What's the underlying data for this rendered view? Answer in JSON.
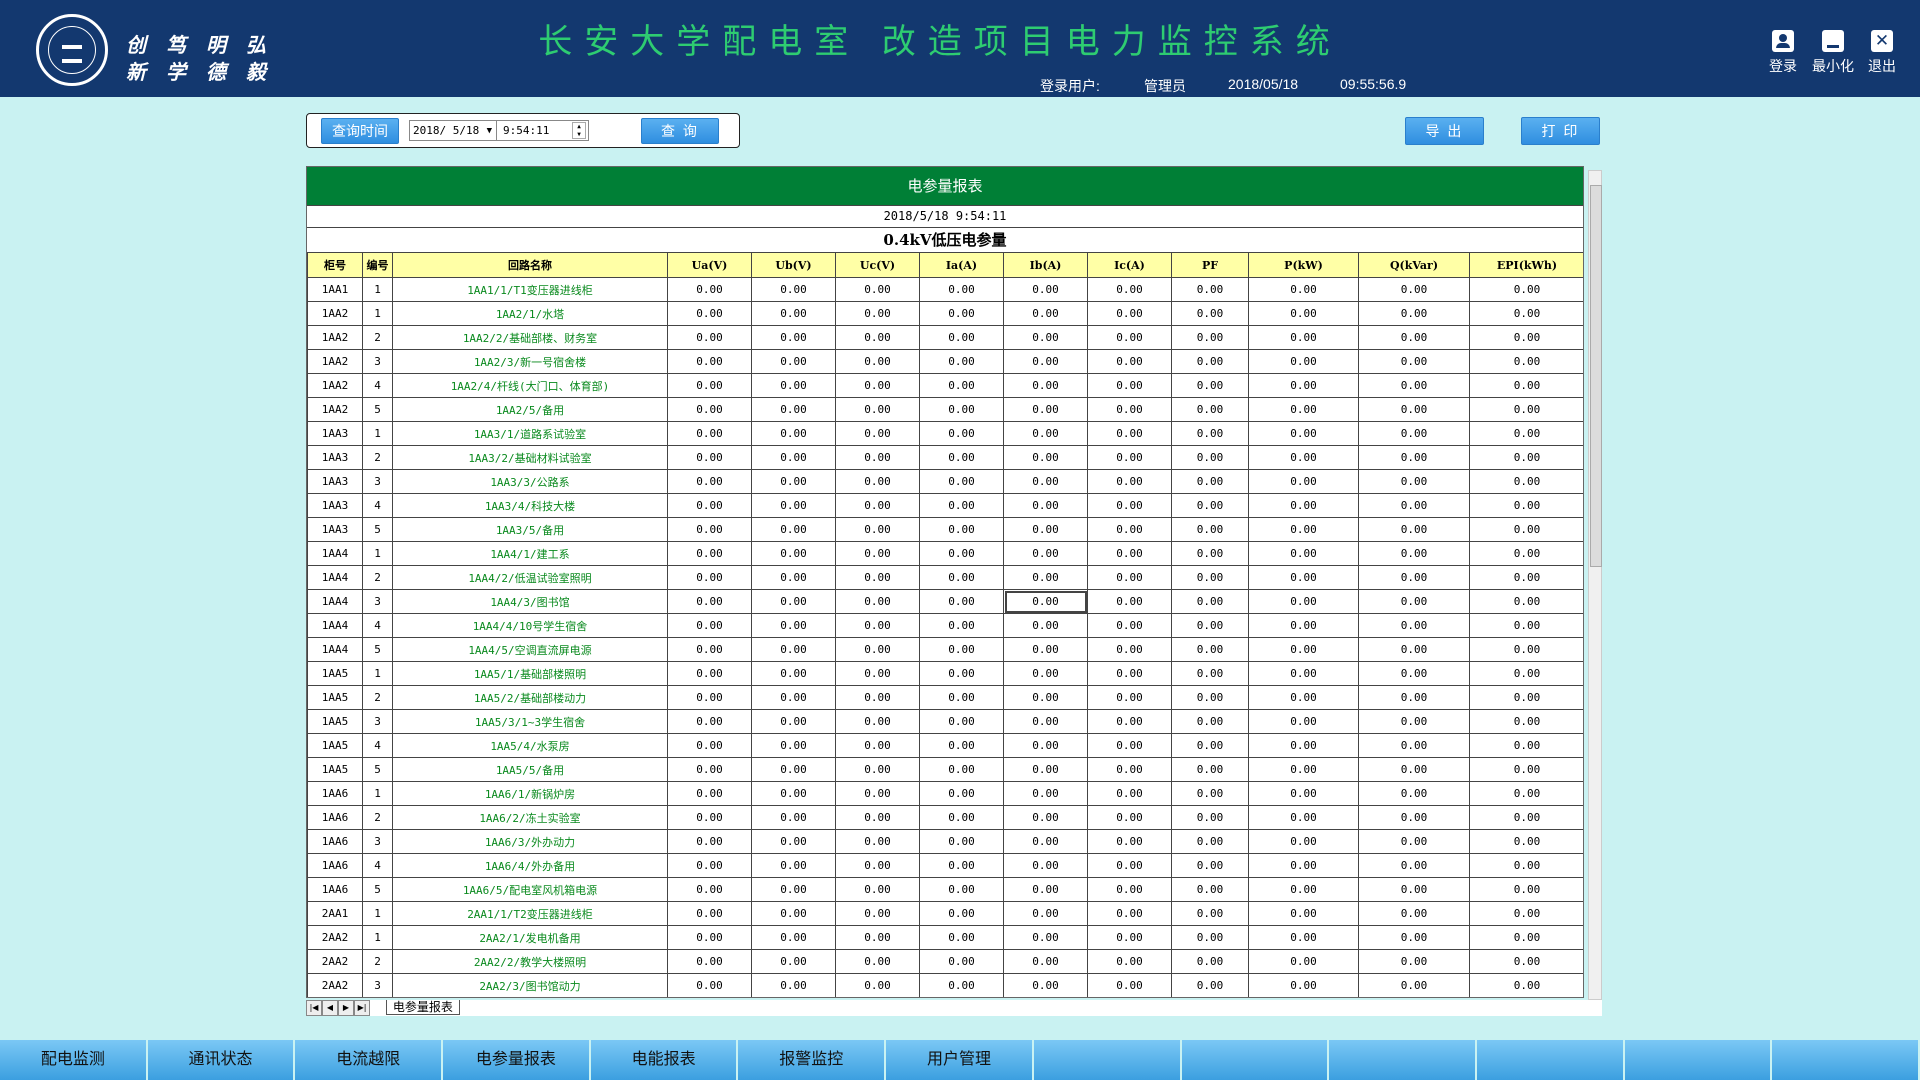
{
  "header": {
    "motto": [
      "创",
      "笃",
      "明",
      "弘",
      "新",
      "学",
      "德",
      "毅"
    ],
    "title": "长安大学配电室 改造项目电力监控系统",
    "login_label": "登录用户:",
    "user": "管理员",
    "date": "2018/05/18",
    "time": "09:55:56.9",
    "buttons": {
      "login": "登录",
      "minimize": "最小化",
      "exit": "退出"
    }
  },
  "query": {
    "label_button": "查询时间",
    "date_value": "2018/ 5/18",
    "time_value": "9:54:11",
    "query_button": "查 询",
    "export_button": "导 出",
    "print_button": "打 印"
  },
  "report": {
    "title": "电参量报表",
    "timestamp": "2018/5/18 9:54:11",
    "subtitle": "0.4kV低压电参量",
    "columns": [
      "柜号",
      "编号",
      "回路名称",
      "Ua(V)",
      "Ub(V)",
      "Uc(V)",
      "Ia(A)",
      "Ib(A)",
      "Ic(A)",
      "PF",
      "P(kW)",
      "Q(kVar)",
      "EPI(kWh)"
    ],
    "rows": [
      [
        "1AA1",
        "1",
        "1AA1/1/T1变压器进线柜"
      ],
      [
        "1AA2",
        "1",
        "1AA2/1/水塔"
      ],
      [
        "1AA2",
        "2",
        "1AA2/2/基础部楼、财务室"
      ],
      [
        "1AA2",
        "3",
        "1AA2/3/新一号宿舍楼"
      ],
      [
        "1AA2",
        "4",
        "1AA2/4/杆线(大门口、体育部)"
      ],
      [
        "1AA2",
        "5",
        "1AA2/5/备用"
      ],
      [
        "1AA3",
        "1",
        "1AA3/1/道路系试验室"
      ],
      [
        "1AA3",
        "2",
        "1AA3/2/基础材料试验室"
      ],
      [
        "1AA3",
        "3",
        "1AA3/3/公路系"
      ],
      [
        "1AA3",
        "4",
        "1AA3/4/科技大楼"
      ],
      [
        "1AA3",
        "5",
        "1AA3/5/备用"
      ],
      [
        "1AA4",
        "1",
        "1AA4/1/建工系"
      ],
      [
        "1AA4",
        "2",
        "1AA4/2/低温试验室照明"
      ],
      [
        "1AA4",
        "3",
        "1AA4/3/图书馆"
      ],
      [
        "1AA4",
        "4",
        "1AA4/4/10号学生宿舍"
      ],
      [
        "1AA4",
        "5",
        "1AA4/5/空调直流屏电源"
      ],
      [
        "1AA5",
        "1",
        "1AA5/1/基础部楼照明"
      ],
      [
        "1AA5",
        "2",
        "1AA5/2/基础部楼动力"
      ],
      [
        "1AA5",
        "3",
        "1AA5/3/1~3学生宿舍"
      ],
      [
        "1AA5",
        "4",
        "1AA5/4/水泵房"
      ],
      [
        "1AA5",
        "5",
        "1AA5/5/备用"
      ],
      [
        "1AA6",
        "1",
        "1AA6/1/新锅炉房"
      ],
      [
        "1AA6",
        "2",
        "1AA6/2/冻土实验室"
      ],
      [
        "1AA6",
        "3",
        "1AA6/3/外办动力"
      ],
      [
        "1AA6",
        "4",
        "1AA6/4/外办备用"
      ],
      [
        "1AA6",
        "5",
        "1AA6/5/配电室风机箱电源"
      ],
      [
        "2AA1",
        "1",
        "2AA1/1/T2变压器进线柜"
      ],
      [
        "2AA2",
        "1",
        "2AA2/1/发电机备用"
      ],
      [
        "2AA2",
        "2",
        "2AA2/2/教学大楼照明"
      ],
      [
        "2AA2",
        "3",
        "2AA2/3/图书馆动力"
      ]
    ],
    "value": "0.00",
    "selected_cell": {
      "row": 13,
      "col": 7
    }
  },
  "sheet_tab": "电参量报表",
  "bottom_nav": [
    "配电监测",
    "通讯状态",
    "电流越限",
    "电参量报表",
    "电能报表",
    "报警监控",
    "用户管理",
    "",
    "",
    "",
    "",
    "",
    ""
  ]
}
